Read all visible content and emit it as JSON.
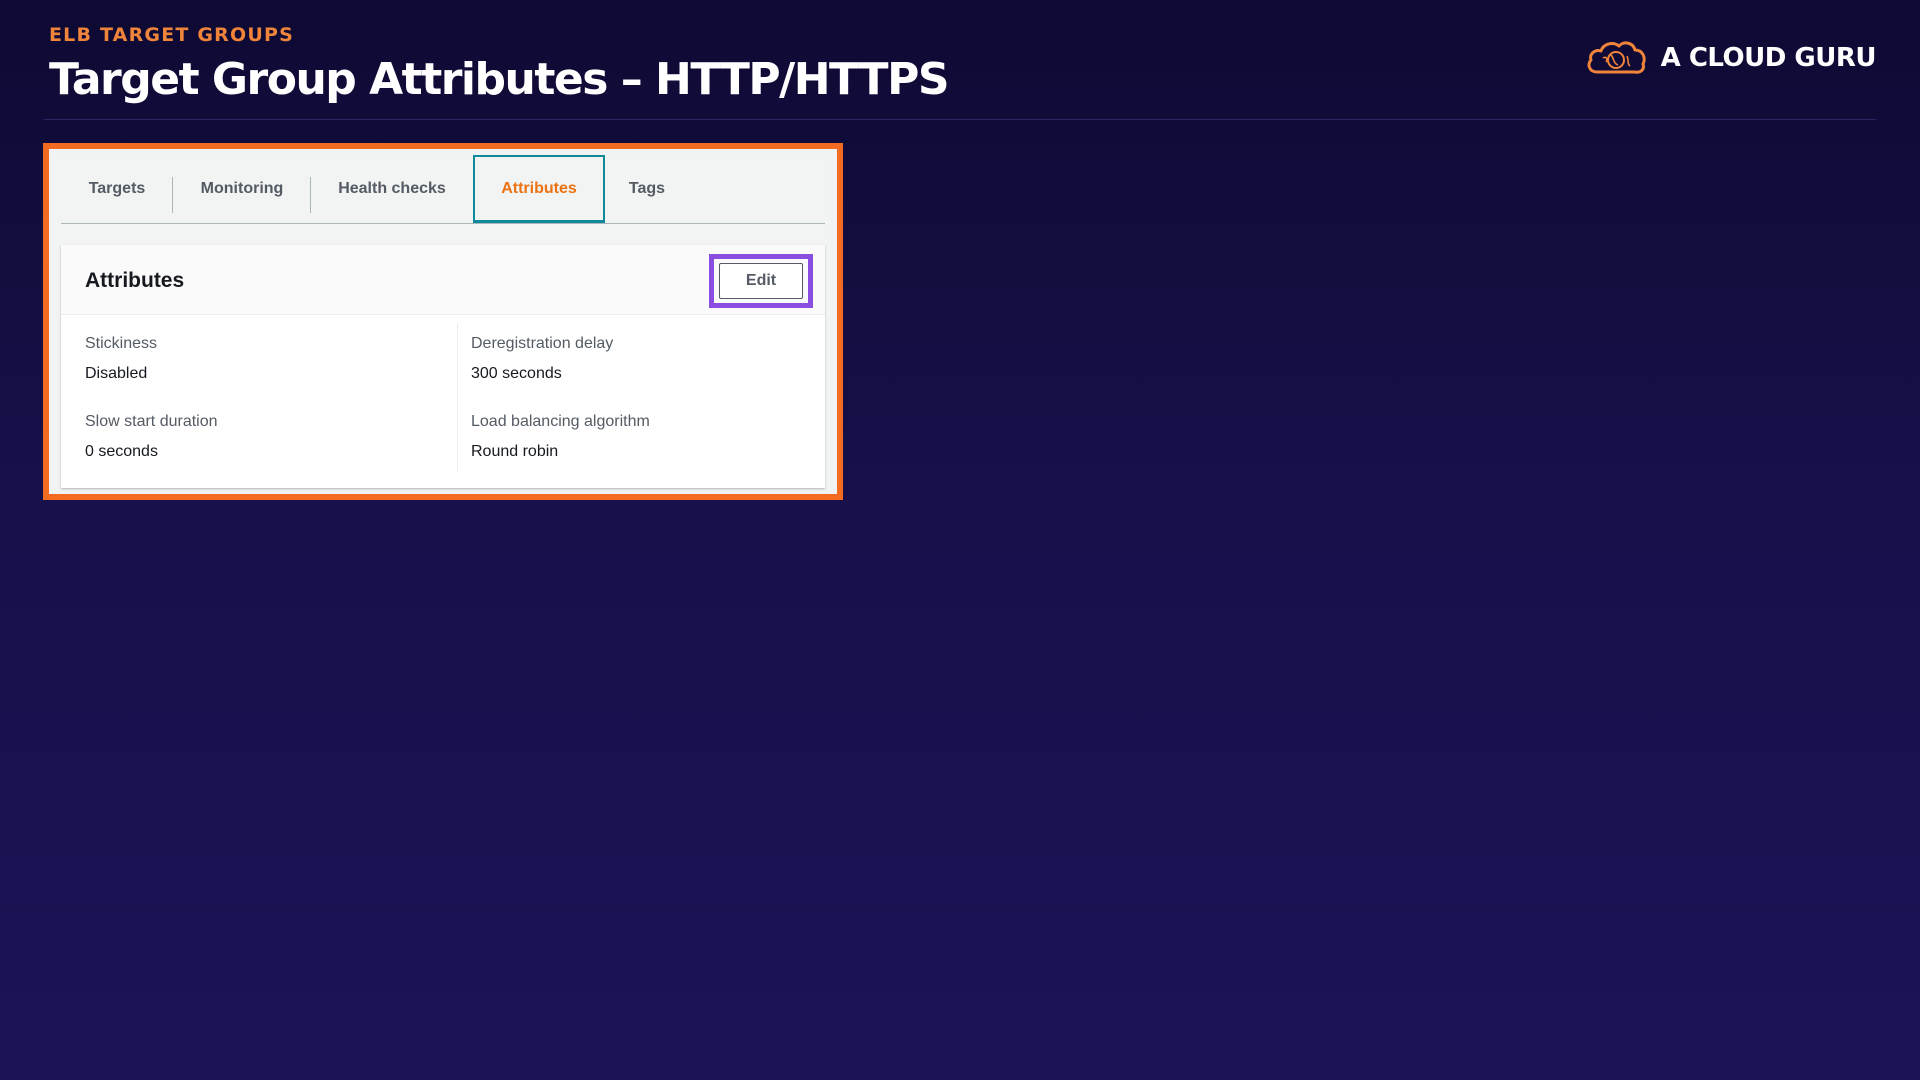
{
  "slide": {
    "kicker": "ELB TARGET GROUPS",
    "title": "Target Group Attributes – HTTP/HTTPS",
    "brand": "A CLOUD GURU"
  },
  "colors": {
    "accent_orange": "#f26b21",
    "edit_highlight": "#8a4fe0",
    "active_tab_border": "#0f8a9c",
    "active_tab_text": "#ec7211"
  },
  "icons": {
    "brand_logo": "cloud-logo-icon"
  },
  "tabs": [
    {
      "label": "Targets",
      "active": false
    },
    {
      "label": "Monitoring",
      "active": false
    },
    {
      "label": "Health checks",
      "active": false
    },
    {
      "label": "Attributes",
      "active": true
    },
    {
      "label": "Tags",
      "active": false
    }
  ],
  "panel": {
    "title": "Attributes",
    "edit_label": "Edit"
  },
  "attributes": [
    {
      "label": "Stickiness",
      "value": "Disabled"
    },
    {
      "label": "Deregistration delay",
      "value": "300 seconds"
    },
    {
      "label": "Slow start duration",
      "value": "0 seconds"
    },
    {
      "label": "Load balancing algorithm",
      "value": "Round robin"
    }
  ]
}
